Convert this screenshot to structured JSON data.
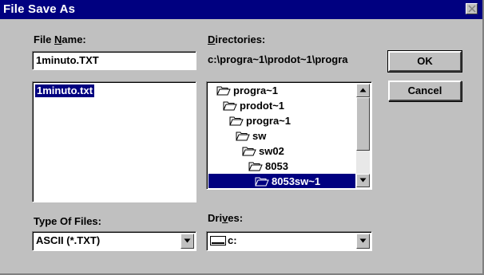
{
  "window": {
    "title": "File Save As",
    "close_icon": "close-icon"
  },
  "file_name": {
    "label_pre": "File ",
    "label_accel": "N",
    "label_post": "ame:",
    "value": "1minuto.TXT"
  },
  "file_list": {
    "items": [
      "1minuto.txt"
    ],
    "selected": "1minuto.txt"
  },
  "directories": {
    "label_accel": "D",
    "label_post": "irectories:",
    "current_path": "c:\\progra~1\\prodot~1\\progra",
    "items": [
      "progra~1",
      "prodot~1",
      "progra~1",
      "sw",
      "sw02",
      "8053",
      "8053sw~1"
    ],
    "selected": "8053sw~1"
  },
  "buttons": {
    "ok": "OK",
    "cancel": "Cancel"
  },
  "type_of_files": {
    "label": "Type Of Files:",
    "value": "ASCII (*.TXT)"
  },
  "drives": {
    "label_pre": "Dri",
    "label_accel": "v",
    "label_post": "es:",
    "value": "c:",
    "icon": "drive-icon"
  },
  "colors": {
    "titlebar": "#000080",
    "face": "#c0c0c0",
    "selection": "#000080"
  }
}
